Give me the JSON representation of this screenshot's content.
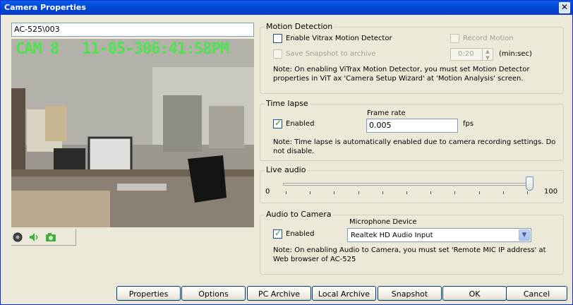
{
  "window": {
    "title": "Camera Properties"
  },
  "camera": {
    "name": "AC-525\\003",
    "overlay_label": "CAM 8",
    "overlay_date": "11-05-30",
    "overlay_time": "6:41:58PM"
  },
  "controls": {
    "icons": [
      "record-icon",
      "speaker-icon",
      "camera-icon"
    ]
  },
  "motion": {
    "legend": "Motion Detection",
    "enable_label": "Enable Vitrax Motion Detector",
    "enable_checked": false,
    "record_label": "Record Motion",
    "record_checked": false,
    "snapshot_label": "Save Snapshot to archive",
    "snapshot_checked": false,
    "interval_value": "0:20",
    "interval_unit": "(min:sec)",
    "note": "Note: On enabling ViTrax Motion Detector, you must set Motion Detector properties in ViT ax 'Camera Setup Wizard' at 'Motion Analysis' screen."
  },
  "timelapse": {
    "legend": "Time lapse",
    "enabled_label": "Enabled",
    "enabled_checked": true,
    "frame_rate_label": "Frame rate",
    "frame_rate_value": "0.005",
    "unit": "fps",
    "note": "Note: Time lapse is automatically enabled due to camera recording settings. Do not disable."
  },
  "live_audio": {
    "legend": "Live audio",
    "min_label": "0",
    "max_label": "100",
    "value": 100
  },
  "audio_to_camera": {
    "legend": "Audio to Camera",
    "enabled_label": "Enabled",
    "enabled_checked": true,
    "mic_label": "Microphone Device",
    "mic_value": "Realtek HD Audio Input",
    "note": "Note: On enabling Audio to Camera, you must set 'Remote MIC IP address' at Web browser of AC-525"
  },
  "buttons": {
    "properties": "Properties",
    "options": "Options",
    "pc_archive": "PC Archive",
    "local_archive": "Local Archive",
    "snapshot": "Snapshot",
    "ok": "OK",
    "cancel": "Cancel"
  },
  "colors": {
    "title_bar": "#0a5fe8",
    "overlay_text": "#51e052",
    "window_bg": "#ece9d8"
  }
}
